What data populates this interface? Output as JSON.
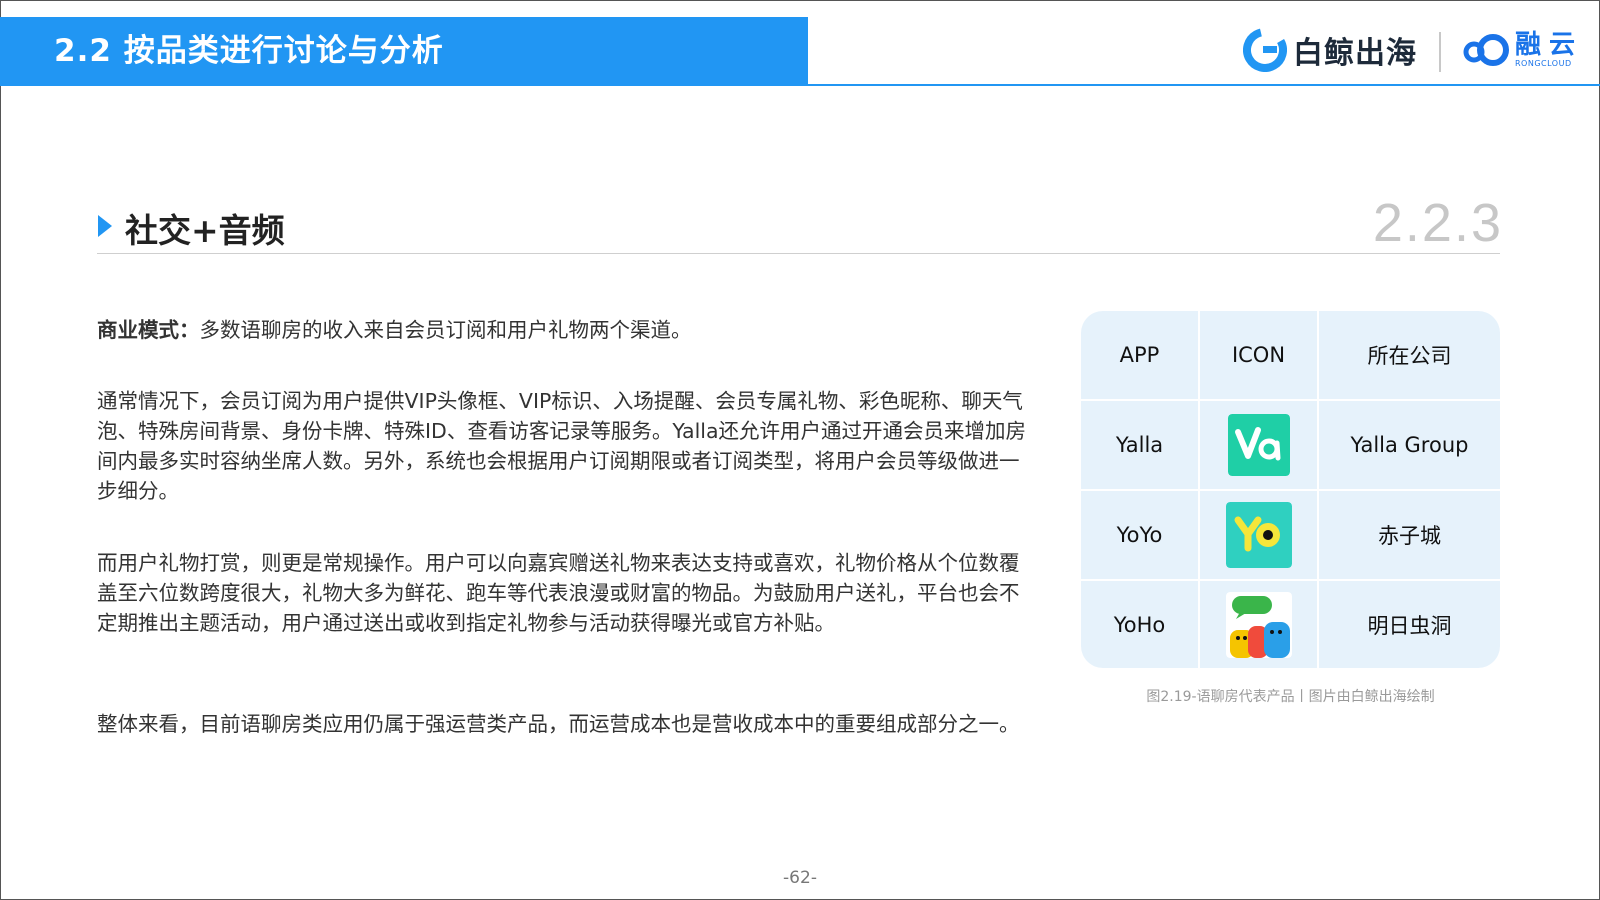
{
  "header": {
    "title": "2.2 按品类进行讨论与分析",
    "logo_baijing_text": "白鲸出海",
    "logo_rongyun_cn": "融云",
    "logo_rongyun_en": "RONGCLOUD",
    "accent_color": "#2196f3"
  },
  "section": {
    "title": "社交+音频",
    "number": "2.2.3"
  },
  "paragraphs": {
    "p1_label": "商业模式：",
    "p1_text": "多数语聊房的收入来自会员订阅和用户礼物两个渠道。",
    "p2": "通常情况下，会员订阅为用户提供VIP头像框、VIP标识、入场提醒、会员专属礼物、彩色昵称、聊天气泡、特殊房间背景、身份卡牌、特殊ID、查看访客记录等服务。Yalla还允许用户通过开通会员来增加房间内最多实时容纳坐席人数。另外，系统也会根据用户订阅期限或者订阅类型，将用户会员等级做进一步细分。",
    "p3": "而用户礼物打赏，则更是常规操作。用户可以向嘉宾赠送礼物来表达支持或喜欢，礼物价格从个位数覆盖至六位数跨度很大，礼物大多为鲜花、跑车等代表浪漫或财富的物品。为鼓励用户送礼，平台也会不定期推出主题活动，用户通过送出或收到指定礼物参与活动获得曝光或官方补贴。",
    "p4": "整体来看，目前语聊房类应用仍属于强运营类产品，而运营成本也是营收成本中的重要组成部分之一。"
  },
  "table": {
    "headers": [
      "APP",
      "ICON",
      "所在公司"
    ],
    "rows": [
      {
        "app": "Yalla",
        "icon": "yalla-app-icon",
        "company": "Yalla Group"
      },
      {
        "app": "YoYo",
        "icon": "yoyo-app-icon",
        "company": "赤子城"
      },
      {
        "app": "YoHo",
        "icon": "yoho-app-icon",
        "company": "明日虫洞"
      }
    ],
    "background": "#e6f2fb"
  },
  "caption": "图2.19-语聊房代表产品丨图片由白鲸出海绘制",
  "page_number": "-62-"
}
